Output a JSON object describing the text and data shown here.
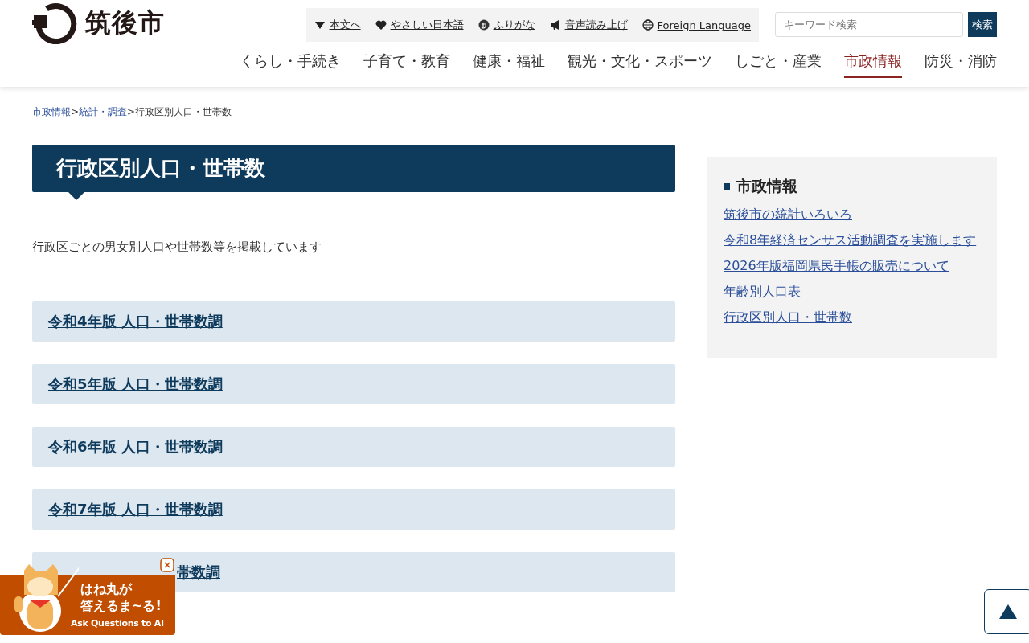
{
  "header": {
    "logo_text": "筑後市",
    "utility_links": [
      {
        "kind": "skip",
        "label": "本文へ"
      },
      {
        "kind": "easy",
        "label": "やさしい日本語"
      },
      {
        "kind": "furigana",
        "label": "ふりがな"
      },
      {
        "kind": "speech",
        "label": "音声読み上げ"
      },
      {
        "kind": "language",
        "label": "Foreign Language"
      }
    ],
    "search": {
      "placeholder": "キーワード検索",
      "button": "検索"
    },
    "nav": [
      {
        "label": "くらし・手続き",
        "selected": false
      },
      {
        "label": "子育て・教育",
        "selected": false
      },
      {
        "label": "健康・福祉",
        "selected": false
      },
      {
        "label": "観光・文化・スポーツ",
        "selected": false
      },
      {
        "label": "しごと・産業",
        "selected": false
      },
      {
        "label": "市政情報",
        "selected": true
      },
      {
        "label": "防災・消防",
        "selected": false
      }
    ]
  },
  "breadcrumb": {
    "links": [
      {
        "label": "市政情報",
        "separator": ">"
      },
      {
        "label": "統計・調査",
        "separator": ">"
      }
    ],
    "current": "行政区別人口・世帯数"
  },
  "page_title": "行政区別人口・世帯数",
  "description": "行政区ごとの男女別人口や世帯数等を掲載しています",
  "sections": [
    {
      "label": "令和4年版 人口・世帯数調"
    },
    {
      "label": "令和5年版 人口・世帯数調"
    },
    {
      "label": "令和6年版 人口・世帯数調"
    },
    {
      "label": "令和7年版 人口・世帯数調"
    },
    {
      "label": "帯数調",
      "partly_covered": true
    }
  ],
  "sidebar": {
    "heading": "市政情報",
    "links": [
      "筑後市の統計いろいろ",
      "令和8年経済センサス活動調査を実施します",
      "2026年版福岡県民手帳の販売について",
      "年齢別人口表",
      "行政区別人口・世帯数"
    ]
  },
  "ai_widget": {
    "title_lines": [
      "はね丸が",
      "答えるま~る!"
    ],
    "subtitle": "Ask Questions to AI"
  }
}
